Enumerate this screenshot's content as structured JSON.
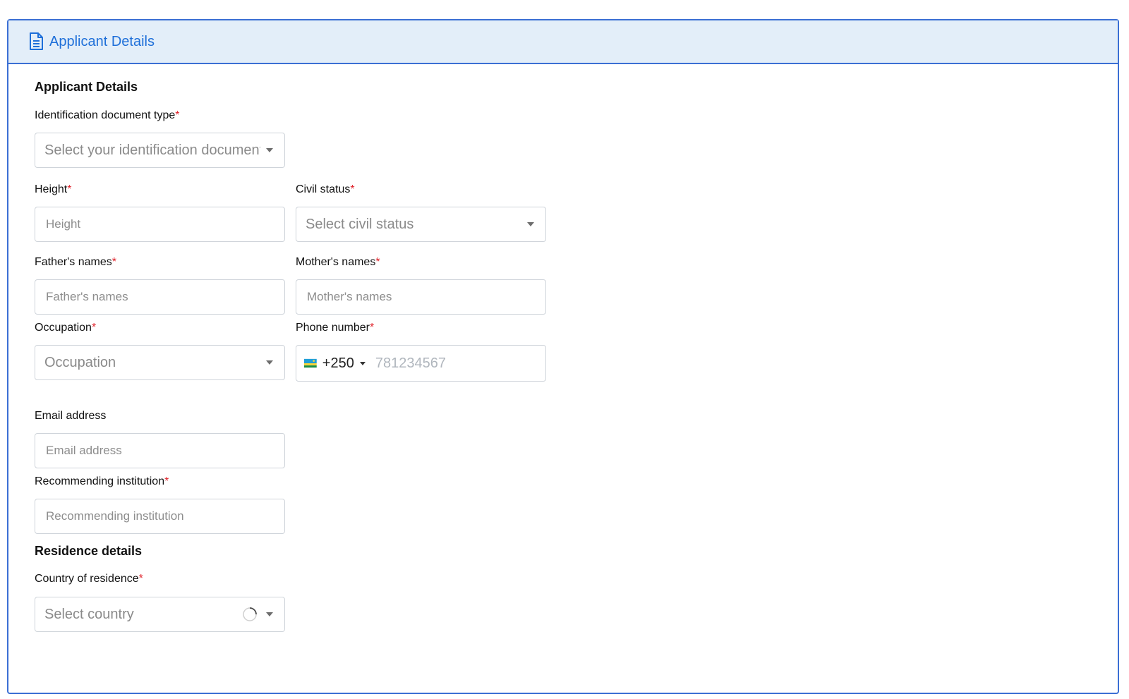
{
  "header": {
    "title": "Applicant Details",
    "icon": "document-icon",
    "accent": "#1e6fd9"
  },
  "applicant": {
    "section_title": "Applicant Details",
    "id_doc": {
      "label": "Identification document type",
      "placeholder": "Select your identification document",
      "required": "*"
    },
    "height": {
      "label": "Height",
      "placeholder": "Height",
      "required": "*"
    },
    "civil_status": {
      "label": "Civil status",
      "placeholder": "Select civil status",
      "required": "*"
    },
    "father": {
      "label": "Father's names",
      "placeholder": "Father's names",
      "required": "*"
    },
    "mother": {
      "label": "Mother's names",
      "placeholder": "Mother's names",
      "required": "*"
    },
    "occupation": {
      "label": "Occupation",
      "placeholder": "Occupation",
      "required": "*"
    },
    "phone": {
      "label": "Phone number",
      "dial_code": "+250",
      "placeholder": "781234567",
      "required": "*",
      "country_flag": "rwanda-flag-icon"
    },
    "email": {
      "label": "Email address",
      "placeholder": "Email address"
    },
    "recommending": {
      "label": "Recommending institution",
      "placeholder": "Recommending institution",
      "required": "*"
    }
  },
  "residence": {
    "section_title": "Residence details",
    "country": {
      "label": "Country of residence",
      "placeholder": "Select country",
      "required": "*",
      "loading_icon": "spinner-icon"
    }
  },
  "colors": {
    "border": "#3b6fd4",
    "header_bg": "#e3eef9",
    "required": "#e0242c"
  }
}
